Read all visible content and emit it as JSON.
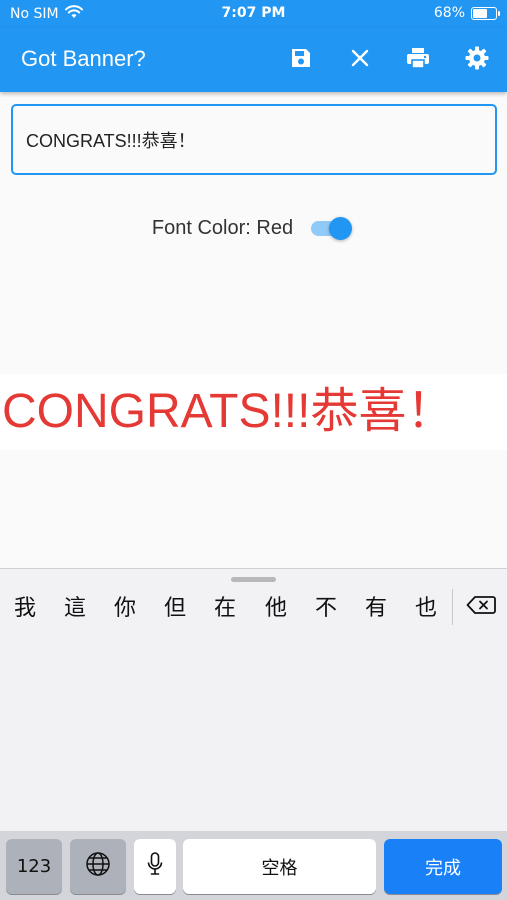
{
  "status_bar": {
    "carrier": "No SIM",
    "time": "7:07 PM",
    "battery_percent_label": "68%",
    "battery_level": 0.68,
    "icons": [
      "wifi-icon",
      "battery-icon"
    ]
  },
  "app_bar": {
    "title": "Got Banner?",
    "background": "#2196f3",
    "actions": [
      {
        "icon": "save-icon"
      },
      {
        "icon": "close-icon"
      },
      {
        "icon": "print-icon"
      },
      {
        "icon": "settings-icon"
      }
    ]
  },
  "text_field": {
    "value": "CONGRATS!!!恭喜！",
    "border_color": "#2196f3"
  },
  "font_color_toggle": {
    "label": "Font Color: Red",
    "checked": true
  },
  "banner": {
    "text": "CONGRATS!!!恭喜！",
    "color": "#e53935"
  },
  "keyboard": {
    "candidates": [
      "我",
      "這",
      "你",
      "但",
      "在",
      "他",
      "不",
      "有",
      "也"
    ],
    "icons": [
      "backspace-icon",
      "globe-icon",
      "microphone-icon"
    ],
    "keys": {
      "numbers": "123",
      "space": "空格",
      "done": "完成"
    },
    "accent": "#1a80f7"
  }
}
